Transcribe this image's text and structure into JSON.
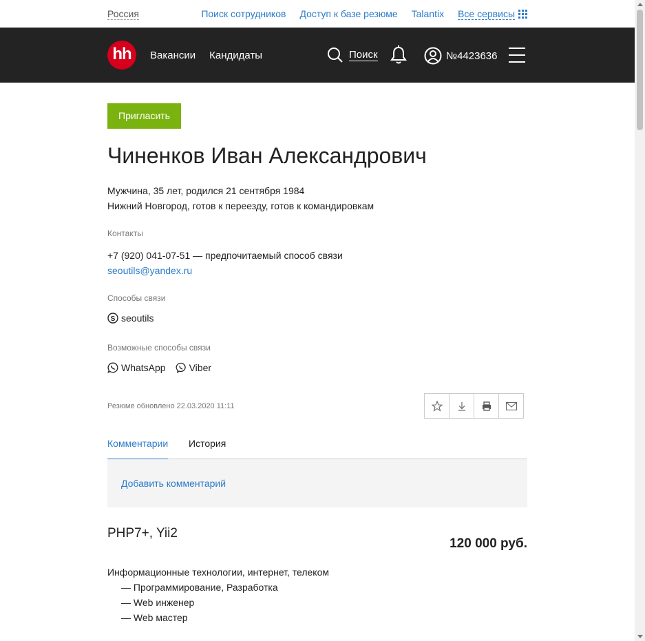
{
  "topbar": {
    "region": "Россия",
    "links": [
      "Поиск сотрудников",
      "Доступ к базе резюме",
      "Talantix"
    ],
    "all_services": "Все сервисы"
  },
  "header": {
    "logo": "hh",
    "nav": [
      "Вакансии",
      "Кандидаты"
    ],
    "search_label": "Поиск",
    "account_label": "№4423636",
    "icons": {
      "search": "search-icon",
      "bell": "bell-icon",
      "account": "user-icon",
      "menu": "menu-icon"
    }
  },
  "resume": {
    "invite_label": "Пригласить",
    "name": "Чиненков Иван Александрович",
    "meta_line1": "Мужчина, 35 лет, родился 21 сентября 1984",
    "meta_line2": "Нижний Новгород, готов к переезду, готов к командировкам",
    "contacts_label": "Контакты",
    "phone": "+7 (920) 041-07-51 — предпочитаемый способ связи",
    "email": "seoutils@yandex.ru",
    "comm_label": "Способы связи",
    "skype": "seoutils",
    "possible_label": "Возможные способы связи",
    "whatsapp": "WhatsApp",
    "viber": "Viber",
    "updated": "Резюме обновлено 22.03.2020 11:11"
  },
  "tabs": {
    "comments": "Комментарии",
    "history": "История"
  },
  "comment": {
    "add_label": "Добавить комментарий"
  },
  "job": {
    "position": "PHP7+, Yii2",
    "salary": "120 000 руб.",
    "field": "Информационные технологии, интернет, телеком",
    "specs": [
      "— Программирование, Разработка",
      "— Web инженер",
      "— Web мастер"
    ]
  },
  "colors": {
    "brand": "#d6001c",
    "accent": "#2b7bc9",
    "invite": "#7ab30f",
    "header_bg": "#232323"
  }
}
